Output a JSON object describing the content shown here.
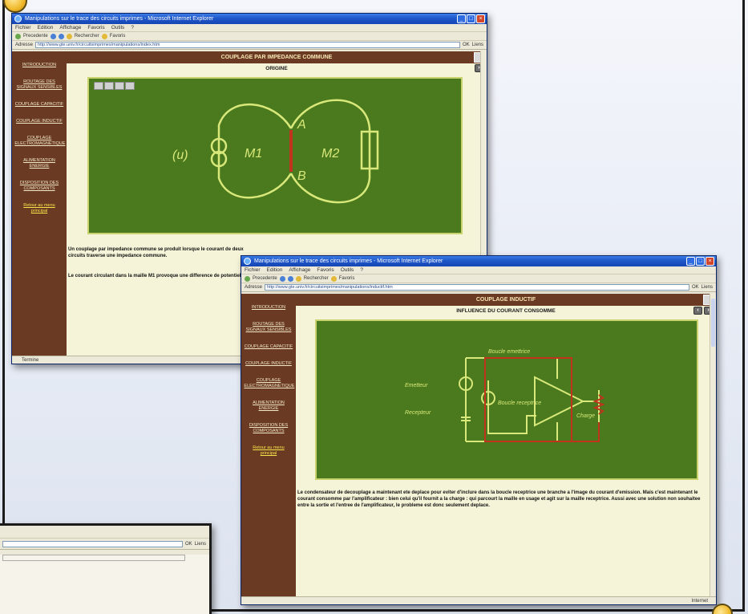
{
  "window1": {
    "title": "Manipulations sur le trace des circuits imprimes - Microsoft Internet Explorer",
    "menu": [
      "Fichier",
      "Edition",
      "Affichage",
      "Favoris",
      "Outils",
      "?"
    ],
    "toolbar": [
      "Precedente",
      "Rechercher",
      "Favoris"
    ],
    "address_label": "Adresse",
    "address": "http://www.gte.univ.fr/circuitsimprimes/manipulations/index.htm",
    "go": "OK",
    "links": "Liens",
    "sidebar": [
      "INTRODUCTION",
      "ROUTAGE DES SIGNAUX SENSIBLES",
      "COUPLAGE CAPACITIF",
      "COUPLAGE INDUCTIF",
      "COUPLAGE ELECTROMAGNETIQUE",
      "ALIMENTATION ENERGIE",
      "DISPOSITION DES COMPOSANTS",
      "Retour au menu principal"
    ],
    "header": "COUPLAGE PAR IMPEDANCE COMMUNE",
    "subtitle": "ORIGINE",
    "schema_labels": {
      "source": "(u)",
      "m1": "M1",
      "m2": "M2",
      "a": "A",
      "b": "B"
    },
    "paragraph1": "Un couplage par impedance commune se produit lorsque le courant de deux circuits traverse une impedance commune.",
    "paragraph2": "Le courant circulant dans la maille M1 provoque une difference de potentiel",
    "status": "Termine"
  },
  "window2": {
    "title": "Manipulations sur le trace des circuits imprimes - Microsoft Internet Explorer",
    "menu": [
      "Fichier",
      "Edition",
      "Affichage",
      "Favoris",
      "Outils",
      "?"
    ],
    "toolbar": [
      "Precedente",
      "Rechercher",
      "Favoris"
    ],
    "address_label": "Adresse",
    "address": "http://www.gte.univ.fr/circuitsimprimes/manipulations/inductif.htm",
    "go": "OK",
    "links": "Liens",
    "sidebar": [
      "INTRODUCTION",
      "ROUTAGE DES SIGNAUX SENSIBLES",
      "COUPLAGE CAPACITIF",
      "COUPLAGE INDUCTIF",
      "COUPLAGE ELECTROMAGNETIQUE",
      "ALIMENTATION ENERGIE",
      "DISPOSITION DES COMPOSANTS",
      "Retour au menu principal"
    ],
    "header": "COUPLAGE INDUCTIF",
    "subtitle": "INFLUENCE DU COURANT CONSOMME",
    "schema_labels": {
      "top": "Boucle emettrice",
      "source1": "Emetteur",
      "source2": "Recepteur",
      "loop": "Boucle receptrice",
      "load": "Charge"
    },
    "paragraph": "Le condensateur de decouplage a maintenant ete deplace pour eviter d'inclure dans la boucle receptrice une branche a l'image du courant d'emission. Mais c'est maintenant le courant consomme par l'amplificateur : bien celui qu'il fournit a la charge : qui parcourt la maille en usage et agit sur la maille receptrice. Aussi avec une solution non souhaitee entre la sortie et l'entree de l'amplificateur, le probleme est donc seulement deplace.",
    "status": "Internet"
  },
  "window3": {
    "go": "OK",
    "links": "Liens"
  },
  "colors": {
    "sidebar": "#6b3a22",
    "schema_bg": "#4a7a1d",
    "wire": "#d9e87a",
    "highlight": "#c0331c",
    "titlebar": "#1f57c9"
  }
}
